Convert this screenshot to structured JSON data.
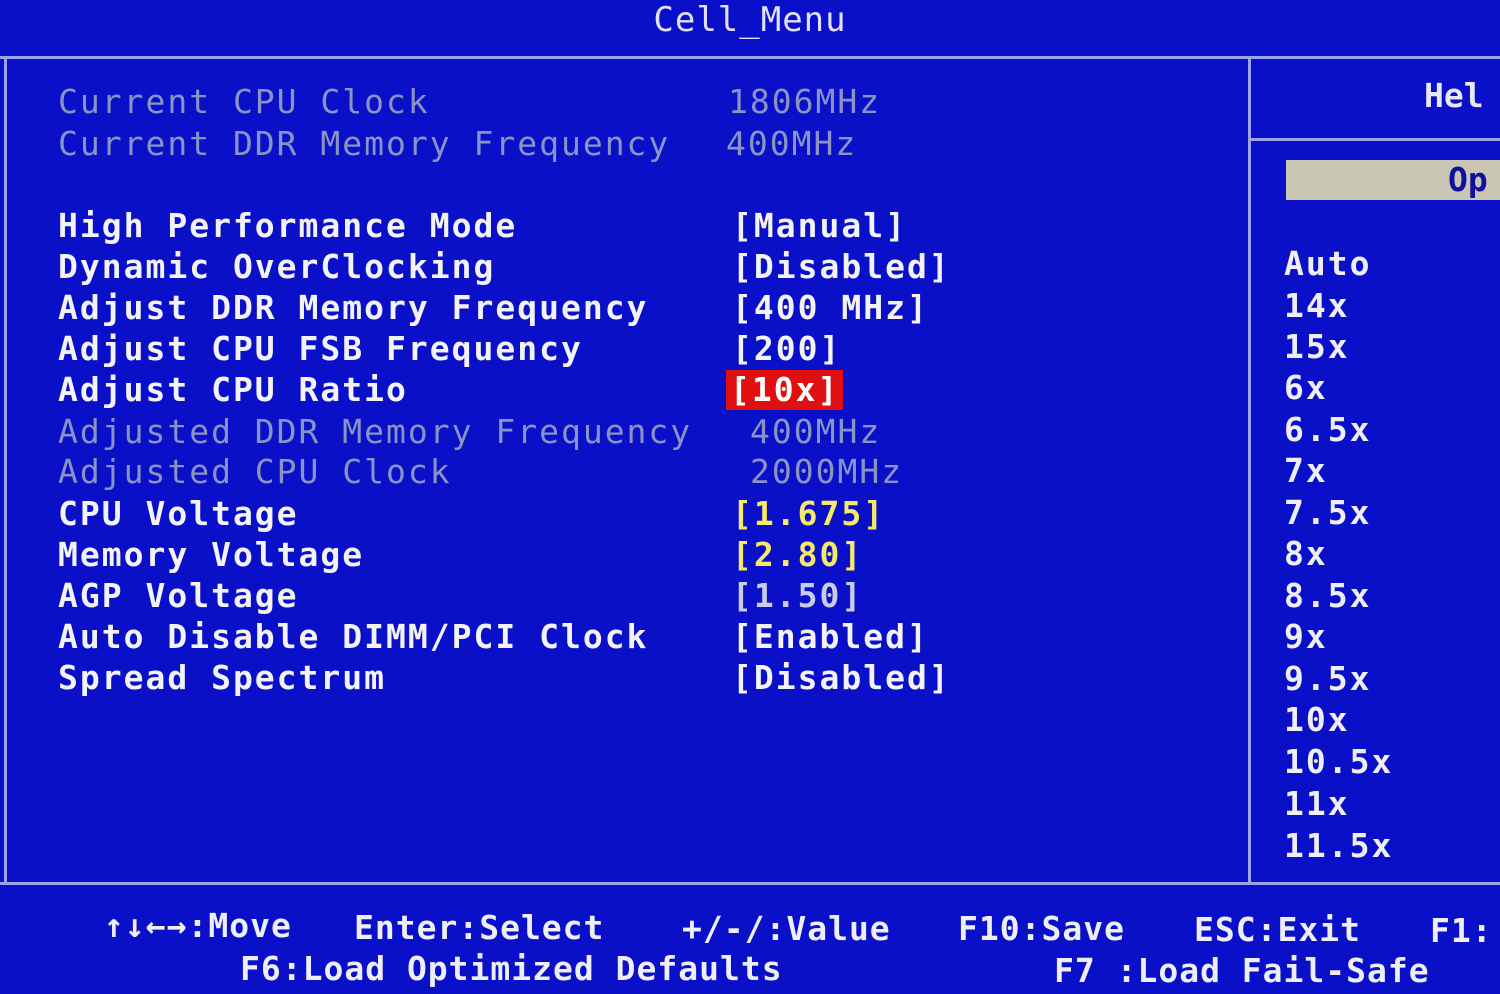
{
  "title": "Cell_Menu",
  "info_rows": [
    {
      "label": "Current CPU Clock",
      "value": "1806MHz"
    },
    {
      "label": "Current DDR Memory Frequency",
      "value": "400MHz"
    }
  ],
  "settings": [
    {
      "label": "High Performance Mode",
      "value": "[Manual]"
    },
    {
      "label": "Dynamic OverClocking",
      "value": "[Disabled]"
    },
    {
      "label": "Adjust DDR Memory Frequency",
      "value": "[400 MHz]"
    },
    {
      "label": "Adjust CPU FSB Frequency",
      "value": "[200]"
    },
    {
      "label": "Adjust CPU Ratio",
      "value": "[10x]"
    },
    {
      "label": "Adjusted DDR Memory Frequency",
      "value": "400MHz"
    },
    {
      "label": "Adjusted CPU Clock",
      "value": "2000MHz"
    },
    {
      "label": "CPU Voltage",
      "value": "[1.675]"
    },
    {
      "label": "Memory Voltage",
      "value": "[2.80]"
    },
    {
      "label": "AGP Voltage",
      "value": "[1.50]"
    },
    {
      "label": "Auto Disable DIMM/PCI Clock",
      "value": "[Enabled]"
    },
    {
      "label": "Spread Spectrum",
      "value": "[Disabled]"
    }
  ],
  "help": {
    "title": "Hel",
    "options_header": "Op",
    "options": [
      "Auto",
      "14x",
      "15x",
      "6x",
      "6.5x",
      "7x",
      "7.5x",
      "8x",
      "8.5x",
      "9x",
      "9.5x",
      "10x",
      "10.5x",
      "11x",
      "11.5x"
    ]
  },
  "footer": {
    "move": "↑↓←→:Move",
    "select": "Enter:Select",
    "value": "+/-/:Value",
    "save": "F10:Save",
    "exit": "ESC:Exit",
    "f1": "F1:",
    "f6": "F6:Load Optimized Defaults",
    "f7": "F7 :Load Fail-Safe"
  },
  "colors": {
    "background": "#0a10c8",
    "selected_highlight": "#e01010",
    "adjustable_value": "#f6e96a",
    "disabled_text": "#8b93c6"
  }
}
